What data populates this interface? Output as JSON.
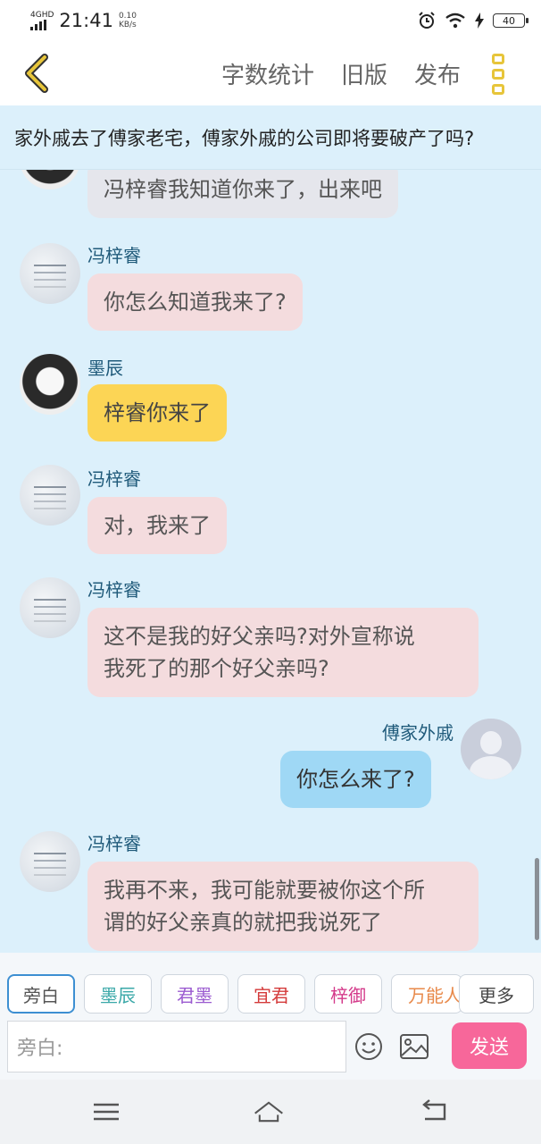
{
  "status": {
    "network": "4GHD",
    "time": "21:41",
    "speed_value": "0.10",
    "speed_unit": "KB/s",
    "battery": "40"
  },
  "toolbar": {
    "word_count": "字数统计",
    "old_version": "旧版",
    "publish": "发布"
  },
  "title": "家外戚去了傅家老宅，傅家外戚的公司即将要破产了吗?",
  "messages": [
    {
      "name": "",
      "text": "冯梓睿我知道你来了，出来吧"
    },
    {
      "name": "冯梓睿",
      "text": "你怎么知道我来了?"
    },
    {
      "name": "墨辰",
      "text": "梓睿你来了"
    },
    {
      "name": "冯梓睿",
      "text": "对，我来了"
    },
    {
      "name": "冯梓睿",
      "line1": "这不是我的好父亲吗?对外宣称说",
      "line2": "我死了的那个好父亲吗?"
    },
    {
      "name": "傅家外戚",
      "text": "你怎么来了?"
    },
    {
      "name": "冯梓睿",
      "line1": "我再不来，我可能就要被你这个所",
      "line2": "谓的好父亲真的就把我说死了"
    }
  ],
  "chips": [
    "旁白",
    "墨辰",
    "君墨",
    "宜君",
    "梓御",
    "万能人",
    "更多"
  ],
  "chip_colors": [
    "#555555",
    "#3aa8a8",
    "#9b5bd0",
    "#d43a3a",
    "#d4398a",
    "#e8894a",
    "#444444"
  ],
  "input": {
    "placeholder": "旁白:",
    "send": "发送"
  },
  "colors": {
    "accent_yellow": "#e7c53a",
    "send_pink": "#f7679a",
    "background": "#dcf0fb"
  }
}
